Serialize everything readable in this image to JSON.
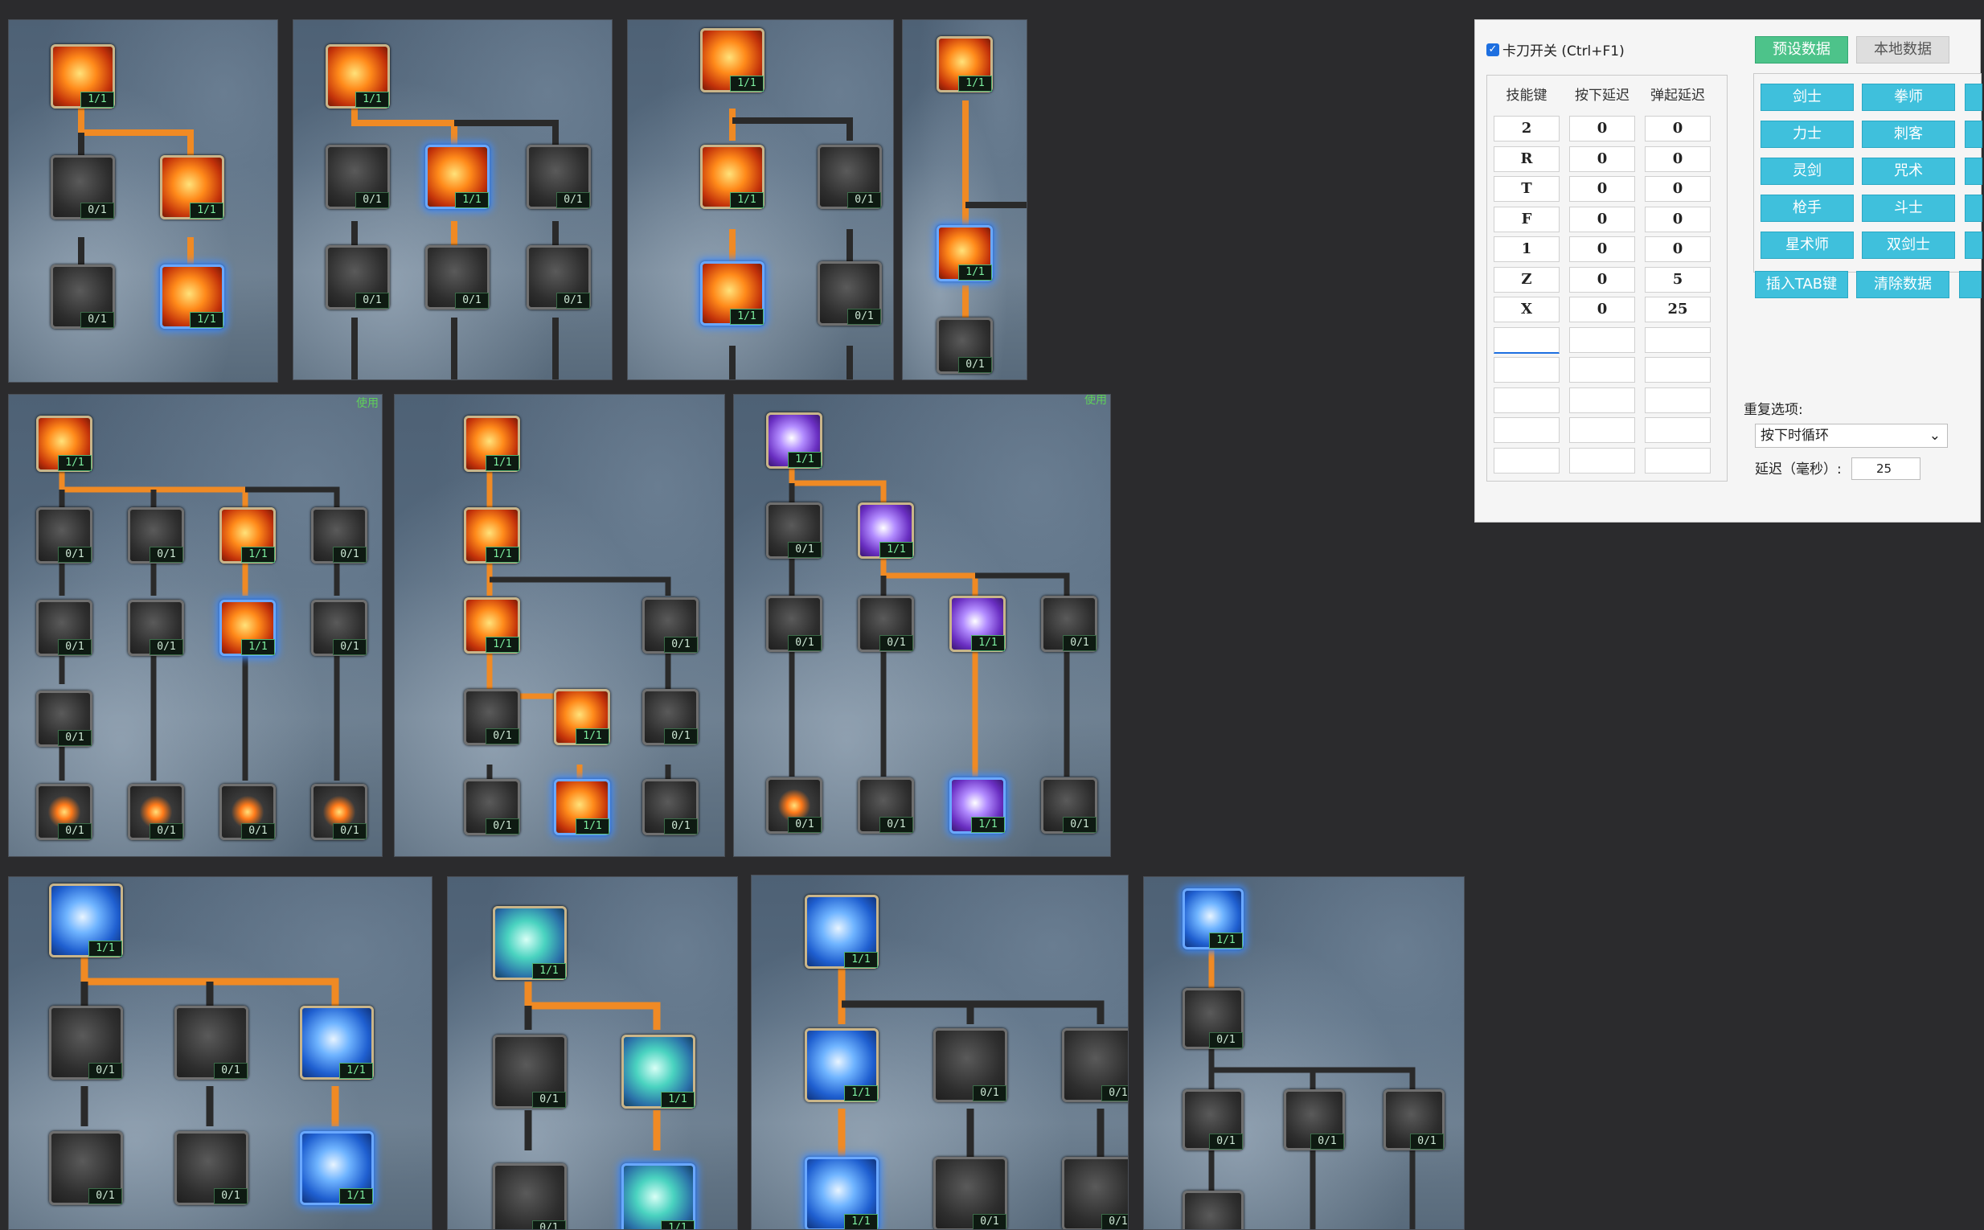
{
  "panel_tags": {
    "use_tag_1": "使用",
    "use_tag_2": "使用"
  },
  "badges": {
    "done": "1/1",
    "empty": "0/1"
  },
  "tool": {
    "toggle_label": "卡刀开关 (Ctrl+F1)",
    "toggle_checked": true,
    "preset_tab": "预设数据",
    "local_tab": "本地数据",
    "table_headers": [
      "技能键",
      "按下延迟",
      "弹起延迟"
    ],
    "rows": [
      {
        "key": "2",
        "press": "0",
        "release": "0"
      },
      {
        "key": "R",
        "press": "0",
        "release": "0"
      },
      {
        "key": "T",
        "press": "0",
        "release": "0"
      },
      {
        "key": "F",
        "press": "0",
        "release": "0"
      },
      {
        "key": "1",
        "press": "0",
        "release": "0"
      },
      {
        "key": "Z",
        "press": "0",
        "release": "5"
      },
      {
        "key": "X",
        "press": "0",
        "release": "25"
      },
      {
        "key": "",
        "press": "",
        "release": ""
      },
      {
        "key": "",
        "press": "",
        "release": ""
      },
      {
        "key": "",
        "press": "",
        "release": ""
      },
      {
        "key": "",
        "press": "",
        "release": ""
      },
      {
        "key": "",
        "press": "",
        "release": ""
      }
    ],
    "classes": [
      "剑士",
      "拳师",
      "力士",
      "刺客",
      "灵剑",
      "咒术",
      "枪手",
      "斗士",
      "星术师",
      "双剑士"
    ],
    "insert_tab_button": "插入TAB键",
    "clear_button": "清除数据",
    "repeat_label": "重复选项:",
    "repeat_value": "按下时循环",
    "delay_label": "延迟（毫秒）:",
    "delay_value": "25"
  },
  "colors": {
    "accent_line": "#f08a24",
    "idle_line": "#2a2a2a",
    "tab_active": "#4dc38a",
    "class_button": "#3fc0dc"
  }
}
